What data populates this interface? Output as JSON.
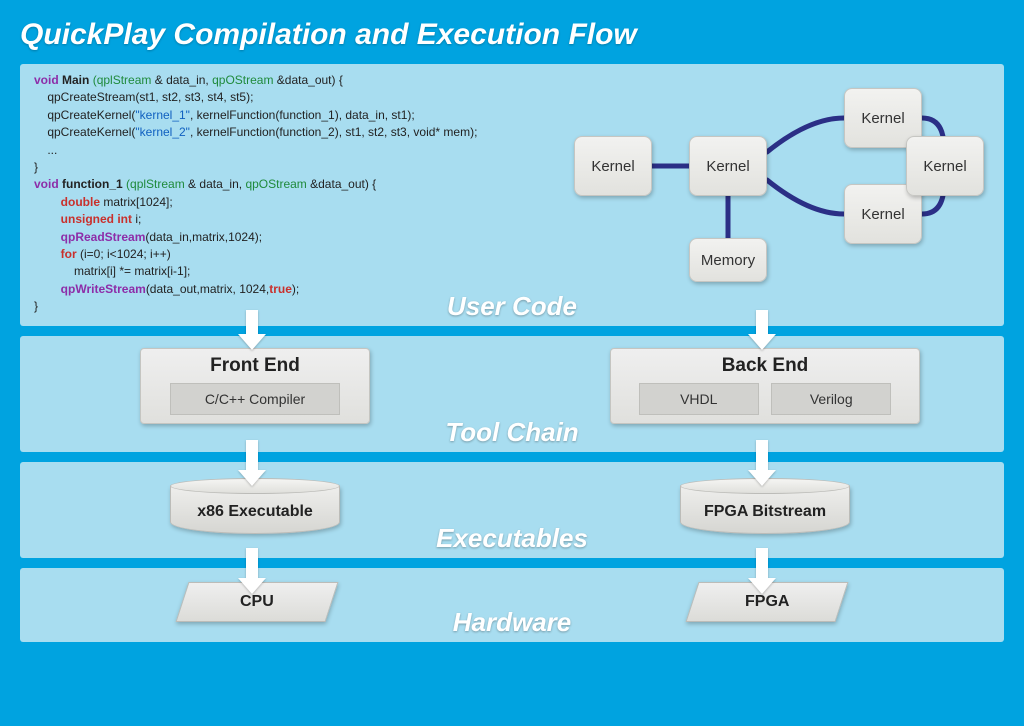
{
  "title": "QuickPlay Compilation and Execution Flow",
  "bands": {
    "user": "User Code",
    "tool": "Tool Chain",
    "exec": "Executables",
    "hw": "Hardware"
  },
  "code": {
    "l1a": "void",
    "l1b": "Main",
    "l1c": "(qplStream",
    "l1d": " & data_in, ",
    "l1e": "qpOStream",
    "l1f": " &data_out) {",
    "l2": "    qpCreateStream(st1, st2, st3, st4, st5);",
    "l3a": "    qpCreateKernel(",
    "l3b": "\"kernel_1\"",
    "l3c": ", kernelFunction(function_1), data_in, st1);",
    "l4a": "    qpCreateKernel(",
    "l4b": "\"kernel_2\"",
    "l4c": ", kernelFunction(function_2), st1, st2, st3, void* mem);",
    "l5": "    ...",
    "l6": "}",
    "l7a": "void",
    "l7b": "function_1",
    "l7c": "(qplStream",
    "l7d": " & data_in, ",
    "l7e": "qpOStream",
    "l7f": " &data_out) {",
    "l8a": "        double",
    "l8b": " matrix[1024];",
    "l9a": "        unsigned int",
    "l9b": " i;",
    "l10a": "        qpReadStream",
    "l10b": "(data_in,matrix,1024);",
    "l11a": "        for",
    "l11b": " (i=0; i<1024; i++)",
    "l12": "            matrix[i] *= matrix[i-1];",
    "l13a": "        qpWriteStream",
    "l13b": "(data_out,matrix, 1024,",
    "l13c": "true",
    "l13d": ");",
    "l14": "}"
  },
  "graph": {
    "k1": "Kernel",
    "k2": "Kernel",
    "k3": "Kernel",
    "k4": "Kernel",
    "k5": "Kernel",
    "mem": "Memory"
  },
  "toolchain": {
    "front_title": "Front End",
    "front_sub": "C/C++ Compiler",
    "back_title": "Back End",
    "back_sub1": "VHDL",
    "back_sub2": "Verilog"
  },
  "exec": {
    "x86": "x86 Executable",
    "fpga": "FPGA Bitstream"
  },
  "hw": {
    "cpu": "CPU",
    "fpga": "FPGA"
  }
}
